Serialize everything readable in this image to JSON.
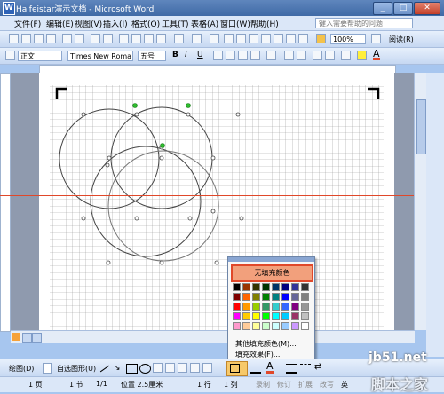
{
  "window": {
    "title": "Haifeistar演示文档 - Microsoft Word",
    "min": "_",
    "max": "□",
    "close": "✕"
  },
  "menu": {
    "items": [
      "文件(F)",
      "编辑(E)",
      "视图(V)",
      "插入(I)",
      "格式(O)",
      "工具(T)",
      "表格(A)",
      "窗口(W)",
      "帮助(H)"
    ],
    "help_placeholder": "键入需要帮助的问题"
  },
  "toolbar": {
    "zoom": "100%",
    "read_button": "阅读(R)"
  },
  "format_bar": {
    "style": "正文",
    "font": "Times New Roma",
    "size": "五号",
    "bold": "B",
    "italic": "I",
    "underline": "U"
  },
  "fill_popup": {
    "no_fill": "无填充颜色",
    "more_colors": "其他填充颜色(M)...",
    "fill_effects": "填充效果(F)...",
    "swatches": [
      [
        "#000000",
        "#993300",
        "#333300",
        "#003300",
        "#003366",
        "#000080",
        "#333399",
        "#333333"
      ],
      [
        "#800000",
        "#ff6600",
        "#808000",
        "#008000",
        "#008080",
        "#0000ff",
        "#666699",
        "#808080"
      ],
      [
        "#ff0000",
        "#ff9900",
        "#99cc00",
        "#339966",
        "#33cccc",
        "#3366ff",
        "#800080",
        "#969696"
      ],
      [
        "#ff00ff",
        "#ffcc00",
        "#ffff00",
        "#00ff00",
        "#00ffff",
        "#00ccff",
        "#993366",
        "#c0c0c0"
      ],
      [
        "#ff99cc",
        "#ffcc99",
        "#ffff99",
        "#ccffcc",
        "#ccffff",
        "#99ccff",
        "#cc99ff",
        "#ffffff"
      ]
    ]
  },
  "drawing_toolbar": {
    "draw_menu": "绘图(D)",
    "autoshapes": "自选图形(U)"
  },
  "status_bar": {
    "page": "1 页",
    "section": "1 节",
    "pages": "1/1",
    "position": "位置 2.5厘米",
    "line": "1 行",
    "col": "1 列",
    "rec": "录制",
    "trk": "修订",
    "ext": "扩展",
    "ovr": "改写",
    "lang": "英"
  },
  "watermark": {
    "site": "jb51.net",
    "name": "脚本之家"
  },
  "colors": {
    "accent_red": "#e0482a",
    "nofill_bg": "#f2a07c"
  }
}
